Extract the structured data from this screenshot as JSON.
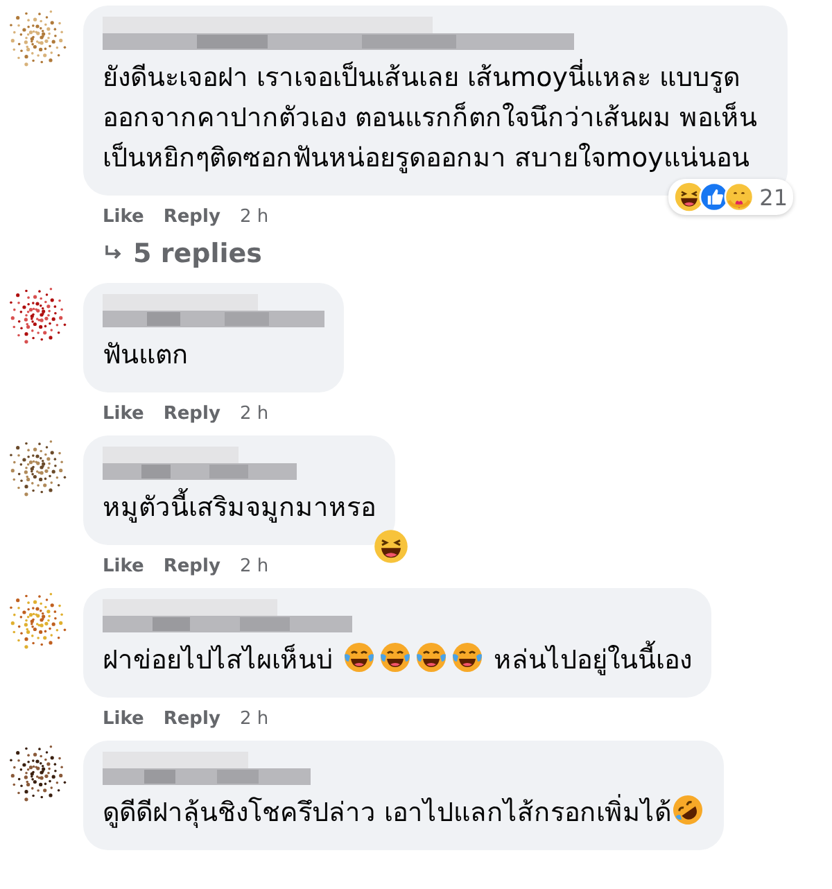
{
  "comments": [
    {
      "body": [
        {
          "kind": "text",
          "text": "ยังดีนะเจอฝา เราเจอเป็นเส้นเลย เส้นmoyนี่แหละ แบบรูดออกจากคาปากตัวเอง ตอนแรกก็ตกใจนึกว่าเส้นผม พอเห็นเป็นหยิกๆติดซอกฟันหน่อยรูดออกมา สบายใจmoyแน่นอน"
        }
      ],
      "reactions": {
        "icons": [
          {
            "kind": "haha"
          },
          {
            "kind": "like"
          },
          {
            "kind": "care"
          }
        ],
        "count": "21"
      },
      "actions": [
        "Like",
        "Reply"
      ],
      "time": "2 h",
      "replies": "5 replies"
    },
    {
      "body": [
        {
          "kind": "text",
          "text": "ฟันแตก"
        }
      ],
      "actions": [
        "Like",
        "Reply"
      ],
      "time": "2 h"
    },
    {
      "body": [
        {
          "kind": "text",
          "text": "หมูตัวนี้เสริมจมูกมาหรอ"
        }
      ],
      "reactions": {
        "icons": [
          {
            "kind": "haha"
          }
        ]
      },
      "actions": [
        "Like",
        "Reply"
      ],
      "time": "2 h"
    },
    {
      "body": [
        {
          "kind": "text",
          "text": "ฝาข่อยไปไสไผเห็นบ่ "
        },
        {
          "kind": "tears"
        },
        {
          "kind": "tears"
        },
        {
          "kind": "tears"
        },
        {
          "kind": "tears"
        },
        {
          "kind": "text",
          "text": " หล่นไปอยู่ในนี้เอง"
        }
      ],
      "actions": [
        "Like",
        "Reply"
      ],
      "time": "2 h"
    },
    {
      "body": [
        {
          "kind": "text",
          "text": "ดูดีดีฝาลุ้นชิงโชครึปล่าว เอาไปแลกไส้กรอกเพิ่มได้"
        },
        {
          "kind": "rofl"
        }
      ]
    }
  ]
}
